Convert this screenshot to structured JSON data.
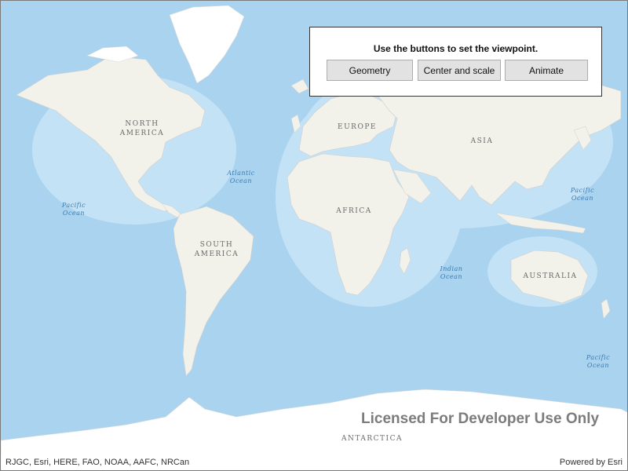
{
  "map": {
    "continents": {
      "north_america": "NORTH\nAMERICA",
      "south_america": "SOUTH\nAMERICA",
      "europe": "EUROPE",
      "asia": "ASIA",
      "africa": "AFRICA",
      "australia": "AUSTRALIA",
      "antarctica": "ANTARCTICA"
    },
    "oceans": {
      "atlantic": "Atlantic\nOcean",
      "pacific_west": "Pacific\nOcean",
      "pacific_east": "Pacific\nOcean",
      "pacific_southeast": "Pacific\nOcean",
      "indian": "Indian\nOcean"
    },
    "colors": {
      "water": "#a9d3ee",
      "land": "#f2f1ea",
      "ice": "#ffffff"
    }
  },
  "panel": {
    "title": "Use the buttons to set the viewpoint.",
    "buttons": {
      "geometry": "Geometry",
      "center_scale": "Center and scale",
      "animate": "Animate"
    }
  },
  "watermark": "Licensed For Developer Use Only",
  "attribution": {
    "sources": "RJGC, Esri, HERE, FAO, NOAA, AAFC, NRCan",
    "powered_by": "Powered by Esri"
  }
}
